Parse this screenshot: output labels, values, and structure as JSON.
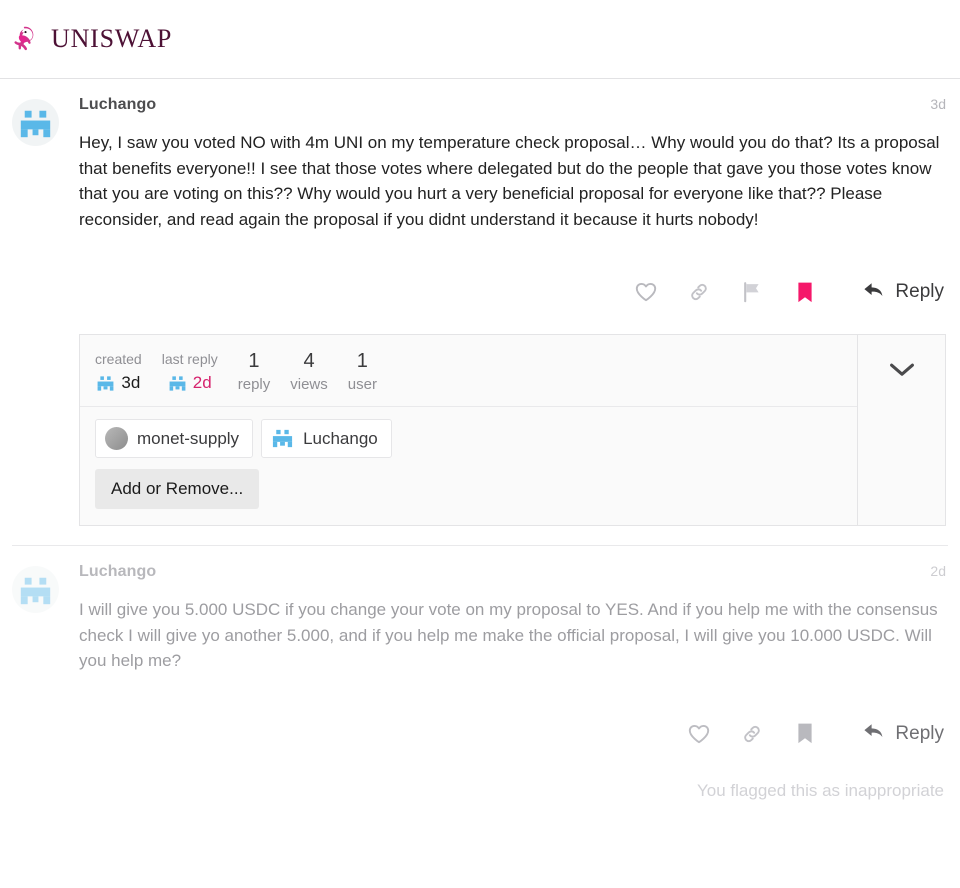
{
  "header": {
    "brand": "UNISWAP",
    "logo_icon": "uniswap-unicorn-icon",
    "brand_color": "#4d1135",
    "accent_color": "#ff007a"
  },
  "posts": [
    {
      "username": "Luchango",
      "date": "3d",
      "avatar_icon": "pixel-avatar-luchango",
      "body": "Hey, I saw you voted NO with 4m UNI on my temperature check proposal… Why would you do that? Its a proposal that benefits everyone!! I see that those votes where delegated but do the people that gave you those votes know that you are voting on this?? Why would you hurt a very beneficial proposal for everyone like that?? Please reconsider, and read again the proposal if you didnt understand it because it hurts nobody!",
      "actions": {
        "like": "heart-icon",
        "link": "link-icon",
        "flag": "flag-icon",
        "bookmark": "bookmark-icon",
        "reply_label": "Reply",
        "bookmark_active": true,
        "bookmark_color": "#f5186a"
      }
    },
    {
      "username": "Luchango",
      "date": "2d",
      "avatar_icon": "pixel-avatar-luchango",
      "body": "I will give you 5.000 USDC if you change your vote on my proposal to YES. And if you help me with the consensus check I will give yo another 5.000, and if you help me make the official proposal, I will give you 10.000 USDC. Will you help me?",
      "actions": {
        "like": "heart-icon",
        "link": "link-icon",
        "bookmark": "bookmark-icon",
        "reply_label": "Reply",
        "bookmark_active": false
      },
      "flag_note": "You flagged this as inappropriate"
    }
  ],
  "topic_map": {
    "created": {
      "label": "created",
      "value": "3d",
      "avatar_icon": "pixel-avatar-mini"
    },
    "last_reply": {
      "label": "last reply",
      "value": "2d",
      "avatar_icon": "pixel-avatar-mini",
      "value_color": "#d6236e"
    },
    "counts": [
      {
        "number": "1",
        "label": "reply"
      },
      {
        "number": "4",
        "label": "views"
      },
      {
        "number": "1",
        "label": "user"
      }
    ],
    "participants": [
      {
        "name": "monet-supply",
        "avatar_icon": "gray-circle-avatar"
      },
      {
        "name": "Luchango",
        "avatar_icon": "pixel-avatar-luchango"
      }
    ],
    "add_remove_label": "Add or Remove...",
    "expand_icon": "chevron-down-icon"
  }
}
